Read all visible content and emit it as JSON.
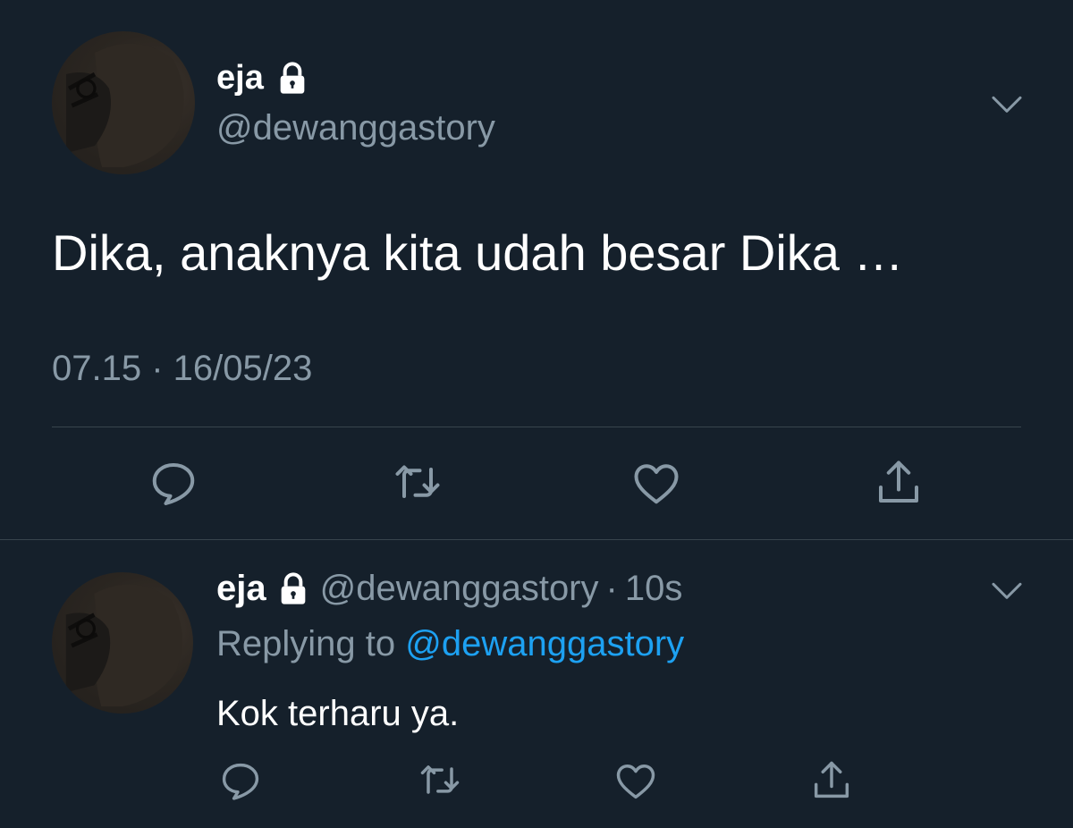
{
  "tweet": {
    "author": {
      "display_name": "eja",
      "handle": "@dewanggastory",
      "avatar": "profile-photo",
      "badge_icon": "lock-icon"
    },
    "text": "Dika, anaknya kita udah besar Dika …",
    "timestamp": "07.15 · 16/05/23",
    "menu_icon": "chevron-down-icon",
    "actions": [
      "reply-icon",
      "retweet-icon",
      "like-icon",
      "share-icon"
    ]
  },
  "reply": {
    "author": {
      "display_name": "eja",
      "handle": "@dewanggastory",
      "avatar": "profile-photo",
      "badge_icon": "lock-icon"
    },
    "separator": "·",
    "age": "10s",
    "replying_prefix": "Replying to",
    "replying_to": "@dewanggastory",
    "text": "Kok terharu ya.",
    "menu_icon": "chevron-down-icon",
    "actions": [
      "reply-icon",
      "retweet-icon",
      "like-icon",
      "share-icon"
    ]
  },
  "colors": {
    "background": "#15202b",
    "primary_text": "#ffffff",
    "secondary_text": "#8899a6",
    "link": "#1da1f2",
    "divider": "#38444d"
  }
}
